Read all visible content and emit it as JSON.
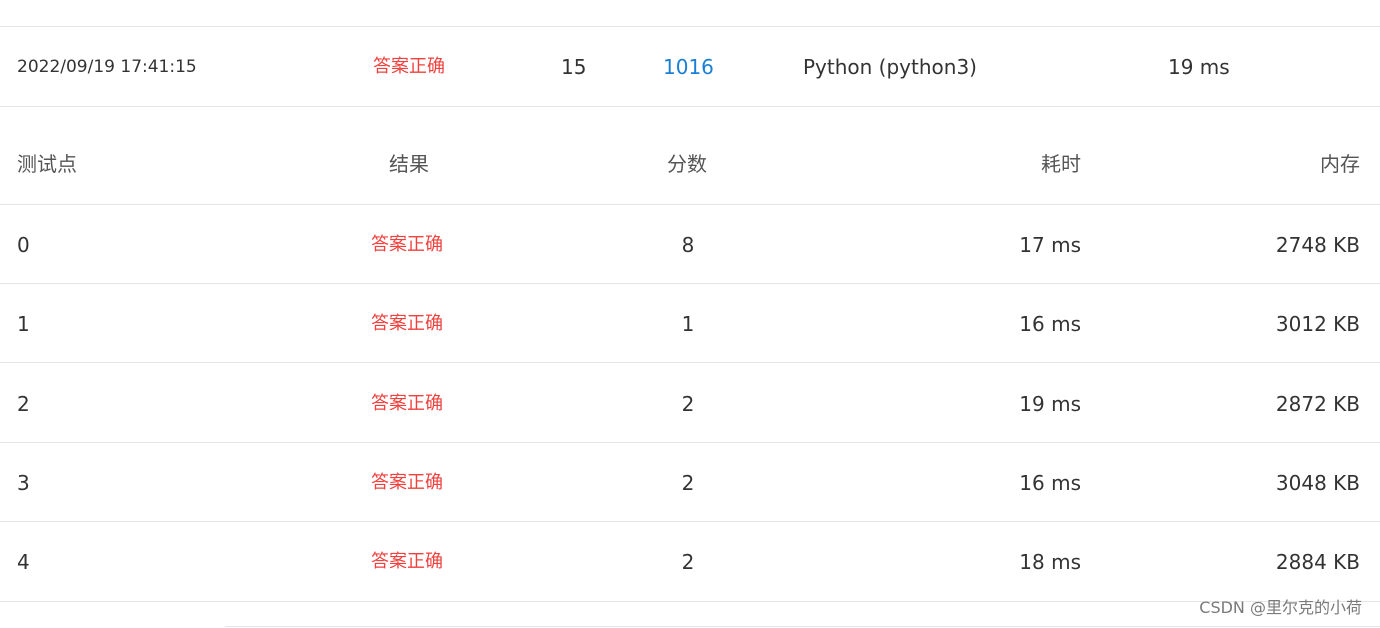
{
  "submission": {
    "time": "2022/09/19 17:41:15",
    "status": "答案正确",
    "score": "15",
    "problem_id": "1016",
    "language": "Python (python3)",
    "time_used": "19 ms"
  },
  "table": {
    "headers": {
      "case": "测试点",
      "result": "结果",
      "score": "分数",
      "time": "耗时",
      "memory": "内存"
    },
    "rows": [
      {
        "case": "0",
        "result": "答案正确",
        "score": "8",
        "time": "17 ms",
        "memory": "2748 KB"
      },
      {
        "case": "1",
        "result": "答案正确",
        "score": "1",
        "time": "16 ms",
        "memory": "3012 KB"
      },
      {
        "case": "2",
        "result": "答案正确",
        "score": "2",
        "time": "19 ms",
        "memory": "2872 KB"
      },
      {
        "case": "3",
        "result": "答案正确",
        "score": "2",
        "time": "16 ms",
        "memory": "3048 KB"
      },
      {
        "case": "4",
        "result": "答案正确",
        "score": "2",
        "time": "18 ms",
        "memory": "2884 KB"
      }
    ]
  },
  "watermark": "CSDN @里尔克的小荷",
  "colors": {
    "status_accepted": "#f0413e",
    "link": "#1a7fd4",
    "divider": "#e6e6e6"
  }
}
